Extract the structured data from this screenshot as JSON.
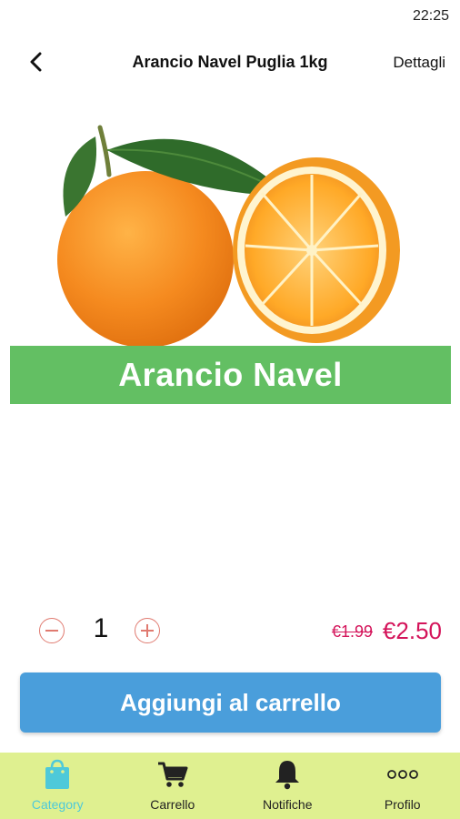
{
  "status": {
    "time": "22:25"
  },
  "header": {
    "title": "Arancio Navel Puglia 1kg",
    "details_label": "Dettagli"
  },
  "product": {
    "banner_text": "Arancio Navel"
  },
  "quantity": {
    "value": "1"
  },
  "price": {
    "old": "€1.99",
    "current": "€2.50"
  },
  "actions": {
    "add_to_cart": "Aggiungi al carrello"
  },
  "nav": {
    "items": [
      {
        "label": "Category",
        "icon": "shopping-bag-icon",
        "active": true
      },
      {
        "label": "Carrello",
        "icon": "cart-icon"
      },
      {
        "label": "Notifiche",
        "icon": "bell-icon"
      },
      {
        "label": "Profilo",
        "icon": "more-dots-icon"
      }
    ]
  },
  "colors": {
    "banner": "#63bf63",
    "button": "#4a9edb",
    "nav_bg": "#dff090",
    "active": "#4ec9d9",
    "price": "#d4145a"
  }
}
